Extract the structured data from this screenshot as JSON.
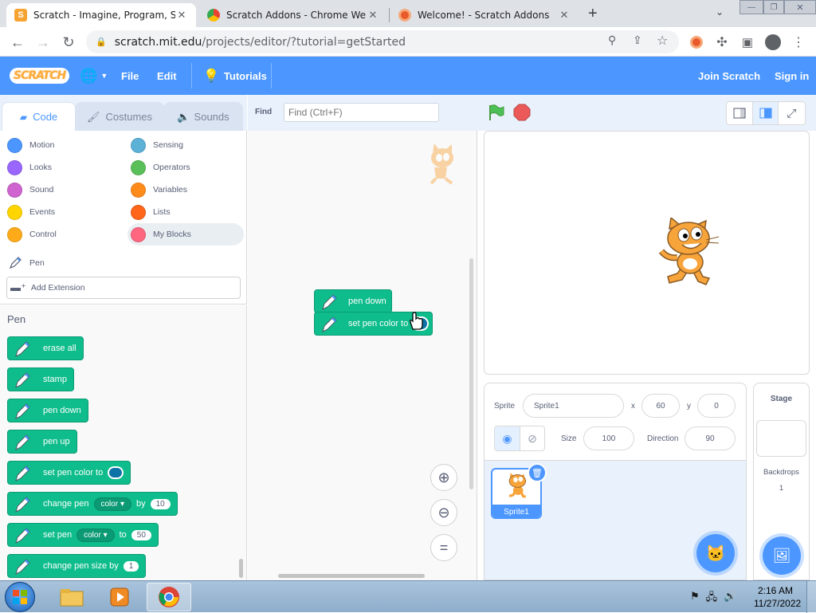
{
  "browser": {
    "tabs": [
      {
        "title": "Scratch - Imagine, Program, Sha",
        "active": true
      },
      {
        "title": "Scratch Addons - Chrome Web S",
        "active": false
      },
      {
        "title": "Welcome! - Scratch Addons",
        "active": false
      }
    ],
    "url_host": "scratch.mit.edu",
    "url_path": "/projects/editor/?tutorial=getStarted"
  },
  "menubar": {
    "logo": "SCRATCH",
    "file": "File",
    "edit": "Edit",
    "tutorials": "Tutorials",
    "join": "Join Scratch",
    "signin": "Sign in"
  },
  "editor_tabs": {
    "code": "Code",
    "costumes": "Costumes",
    "sounds": "Sounds"
  },
  "find": {
    "label": "Find",
    "placeholder": "Find (Ctrl+F)"
  },
  "categories": [
    {
      "label": "Motion",
      "color": "#4c97ff"
    },
    {
      "label": "Looks",
      "color": "#9966ff"
    },
    {
      "label": "Sound",
      "color": "#cf63cf"
    },
    {
      "label": "Events",
      "color": "#ffd500"
    },
    {
      "label": "Control",
      "color": "#ffab19"
    },
    {
      "label": "Sensing",
      "color": "#5cb1d6"
    },
    {
      "label": "Operators",
      "color": "#59c059"
    },
    {
      "label": "Variables",
      "color": "#ff8c1a"
    },
    {
      "label": "Lists",
      "color": "#ff661a"
    },
    {
      "label": "My Blocks",
      "color": "#ff6680"
    }
  ],
  "pen_category": "Pen",
  "add_extension": "Add Extension",
  "palette": {
    "heading": "Pen",
    "blocks": [
      {
        "text": "erase all"
      },
      {
        "text": "stamp"
      },
      {
        "text": "pen down"
      },
      {
        "text": "pen up"
      },
      {
        "text": "set pen color to"
      },
      {
        "text": "change pen",
        "dropdown": "color",
        "mid": "by",
        "value": "10"
      },
      {
        "text": "set pen",
        "dropdown": "color",
        "mid": "to",
        "value": "50"
      },
      {
        "text": "change pen size by",
        "value": "1"
      }
    ]
  },
  "workspace_blocks": [
    "pen down",
    "set pen color to"
  ],
  "sprite": {
    "sprite_label": "Sprite",
    "name": "Sprite1",
    "x_label": "x",
    "x": "60",
    "y_label": "y",
    "y": "0",
    "size_label": "Size",
    "size": "100",
    "direction_label": "Direction",
    "direction": "90",
    "thumb_name": "Sprite1"
  },
  "stage_pane": {
    "title": "Stage",
    "backdrops_label": "Backdrops",
    "backdrops_count": "1"
  },
  "taskbar": {
    "time": "2:16 AM",
    "date": "11/27/2022"
  },
  "colors": {
    "menubar": "#4c97ff",
    "pen_block": "#0fbd8c",
    "accent": "#4c97ff"
  }
}
